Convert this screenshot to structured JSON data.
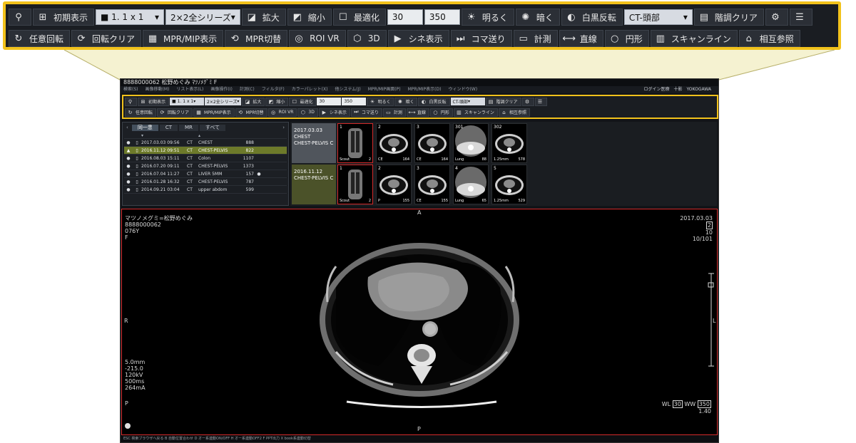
{
  "toolbar": {
    "row1": [
      {
        "icon": "magnifier-icon",
        "label": ""
      },
      {
        "icon": "grid-layout-icon",
        "label": "初期表示"
      },
      {
        "select": true,
        "label": "■ 1. 1 x 1"
      },
      {
        "select": true,
        "label": "2×2全シリーズ"
      },
      {
        "icon": "zoom-in-icon",
        "label": "拡大"
      },
      {
        "icon": "zoom-out-icon",
        "label": "縮小"
      },
      {
        "icon": "fit-icon",
        "label": "最適化"
      },
      {
        "input": true,
        "label": "30"
      },
      {
        "input": true,
        "label": "350"
      },
      {
        "icon": "sun-bright-icon",
        "label": "明るく"
      },
      {
        "icon": "sun-dim-icon",
        "label": "暗く"
      },
      {
        "icon": "invert-icon",
        "label": "白黒反転"
      },
      {
        "select": true,
        "label": "CT-頭部"
      },
      {
        "icon": "tone-clear-icon",
        "label": "階調クリア"
      },
      {
        "icon": "settings-icon",
        "label": ""
      },
      {
        "icon": "panel-icon",
        "label": ""
      }
    ],
    "row2": [
      {
        "icon": "rotate-icon",
        "label": "任意回転"
      },
      {
        "icon": "rotate-clear-icon",
        "label": "回転クリア"
      },
      {
        "icon": "mpr-mip-icon",
        "label": "MPR/MIP表示"
      },
      {
        "icon": "mpr-switch-icon",
        "label": "MPR切替"
      },
      {
        "icon": "roi-vr-icon",
        "label": "ROI VR"
      },
      {
        "icon": "3d-icon",
        "label": "3D"
      },
      {
        "icon": "cine-icon",
        "label": "シネ表示"
      },
      {
        "icon": "frame-step-icon",
        "label": "コマ送り"
      },
      {
        "icon": "measure-icon",
        "label": "計測"
      },
      {
        "icon": "line-icon",
        "label": "直線"
      },
      {
        "icon": "circle-icon",
        "label": "円形"
      },
      {
        "icon": "scanline-icon",
        "label": "スキャンライン"
      },
      {
        "icon": "cross-ref-icon",
        "label": "相互参照"
      }
    ]
  },
  "window": {
    "title": "8888000062 松野めぐみ ﾏﾂﾉﾒｸﾞﾐ F",
    "menu": [
      "検索(S)",
      "画像移動(M)",
      "リスト表示(L)",
      "画像操作(I)",
      "計測(C)",
      "フィルタ(F)",
      "カラーパレット(X)",
      "他システム(J)",
      "MPR/MIP画面(P)",
      "MPR/MIP表示(D)",
      "ウィンドウ(W)"
    ],
    "login_label": "ログイン医療",
    "login_user": "十影",
    "brand": "YOKOGAWA"
  },
  "study_list": {
    "tabs": [
      "同一患",
      "CT",
      "MR",
      "すべて"
    ],
    "active_tab": 0,
    "rows": [
      {
        "date": "2017.03.03 09:56",
        "mod": "CT",
        "desc": "CHEST",
        "count": "888",
        "selected": false
      },
      {
        "date": "2016.11.12 09:51",
        "mod": "CT",
        "desc": "CHEST-PELVIS",
        "count": "822",
        "selected": true
      },
      {
        "date": "2016.08.03 15:11",
        "mod": "CT",
        "desc": "Colon",
        "count": "1107",
        "selected": false
      },
      {
        "date": "2016.07.20 09:11",
        "mod": "CT",
        "desc": "CHEST-PELVIS",
        "count": "1373",
        "selected": false
      },
      {
        "date": "2016.07.04 11:27",
        "mod": "CT",
        "desc": "LIVER 5MM",
        "count": "157",
        "selected": false
      },
      {
        "date": "2016.01.28 16:32",
        "mod": "CT",
        "desc": "CHEST-PELVIS",
        "count": "787",
        "selected": false
      },
      {
        "date": "2014.09.21 03:04",
        "mod": "CT",
        "desc": "upper abdom",
        "count": "599",
        "selected": false
      }
    ]
  },
  "series": [
    {
      "date": "2017.03.03",
      "line1": "CHEST",
      "line2": "CHEST-PELVIS C",
      "thumbs": [
        {
          "num": "1",
          "label": "Scout",
          "count": "2"
        },
        {
          "num": "2",
          "label": "CE",
          "count": "164"
        },
        {
          "num": "3",
          "label": "CE",
          "count": "164"
        },
        {
          "num": "301",
          "label": "Lung",
          "count": "88"
        },
        {
          "num": "302",
          "label": "1.25mm",
          "count": "578"
        }
      ]
    },
    {
      "date": "2016.11.12",
      "line1": "",
      "line2": "CHEST-PELVIS C",
      "thumbs": [
        {
          "num": "1",
          "label": "Scout",
          "count": "2"
        },
        {
          "num": "2",
          "label": "P",
          "count": "155"
        },
        {
          "num": "3",
          "label": "CE",
          "count": "155"
        },
        {
          "num": "4",
          "label": "Lung",
          "count": "65"
        },
        {
          "num": "5",
          "label": "1.25mm",
          "count": "529"
        }
      ]
    }
  ],
  "viewer": {
    "patient_kana": "マツノメグミ=松野めぐみ",
    "patient_id": "8888000062",
    "age": "076Y",
    "sex": "F",
    "study_date": "2017.03.03",
    "series_no": "2",
    "slice_no": "10",
    "image_pos": "10/101",
    "orient_top": "A",
    "orient_bottom": "P",
    "orient_left": "R",
    "orient_right": "L",
    "params": "5.0mm\n-215.0\n120kV\n500ms\n264mA",
    "bottom_left": "P",
    "wl_label": "WL",
    "wl_value": "30",
    "ww_label": "WW",
    "ww_value": "350",
    "zoom": "1.40"
  },
  "status_bar": "ESC 検索ブラウザへ戻る  B 自動位置合わせ  D オー系連動ON/OFF  H オー系連動OFF2  F PPT出力  X book系連動切替"
}
